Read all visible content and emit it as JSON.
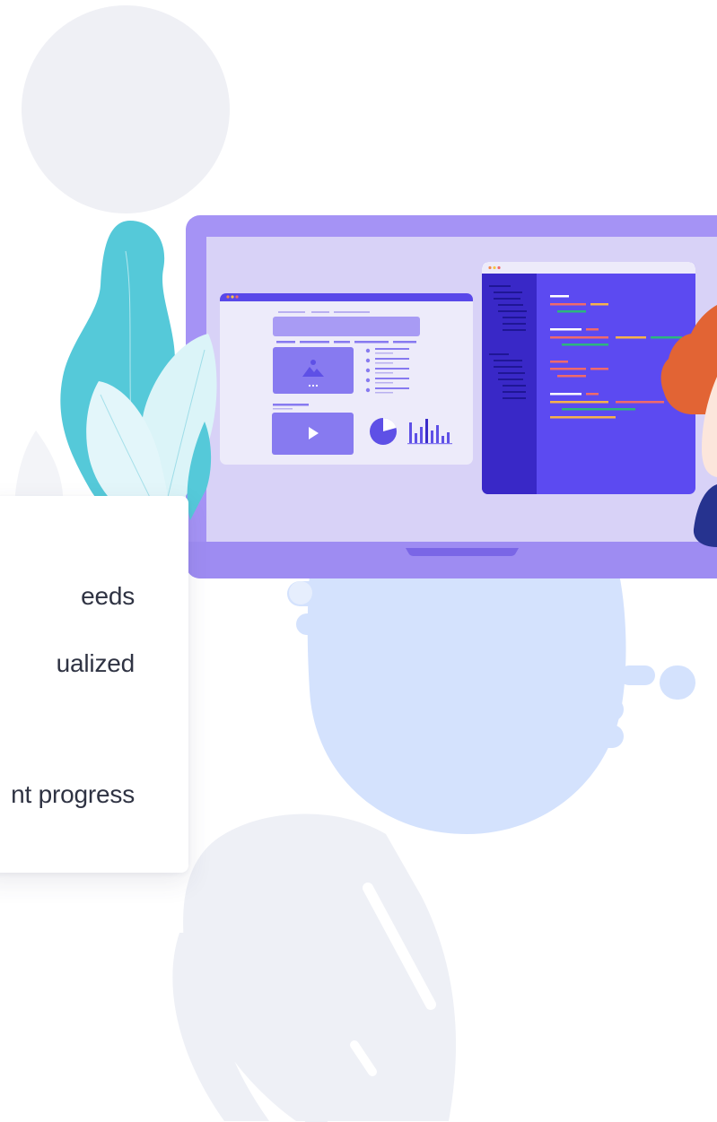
{
  "card": {
    "lines": [
      "eeds",
      "ualized",
      "nt progress"
    ]
  },
  "colors": {
    "laptop_frame": "#A593F5",
    "laptop_screen": "#D8D2F7",
    "code_panel": "#5C4AF1",
    "code_sidebar": "#3928C7",
    "leaf_teal": "#55C9D9",
    "leaf_light": "#DBF4F8",
    "blob_blue": "#D4E2FD",
    "blob_gray": "#EEF0F6",
    "hair": "#E26434",
    "text": "#2F3343"
  },
  "icons": {
    "image": "image-icon",
    "play": "play-icon",
    "pie": "pie-chart-icon",
    "bars": "bar-chart-icon"
  }
}
